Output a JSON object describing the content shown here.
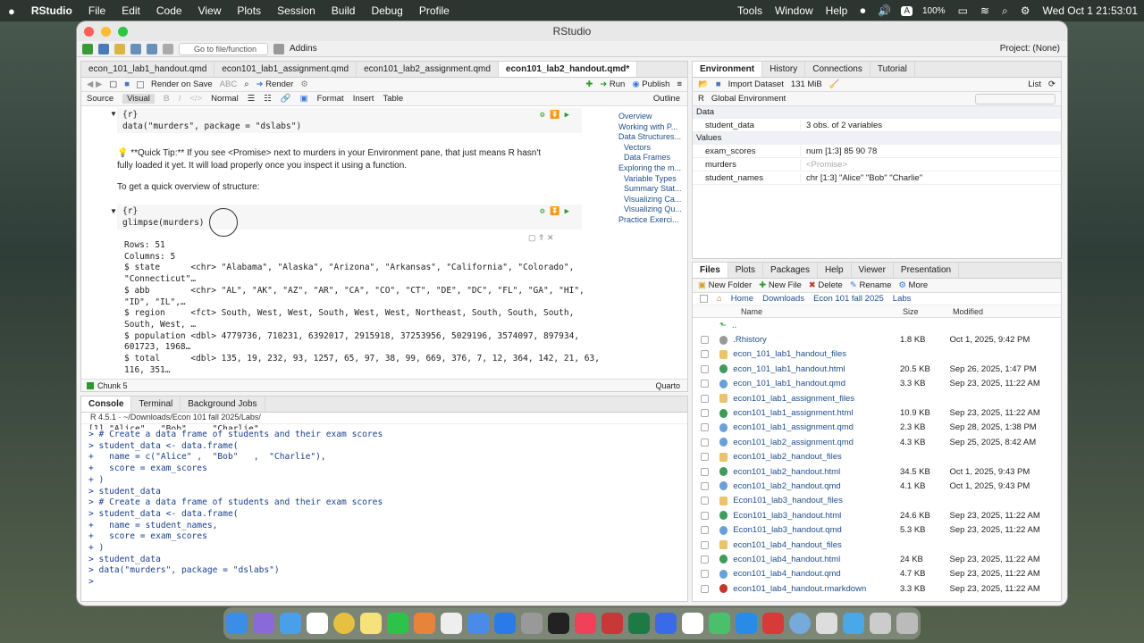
{
  "menubar": {
    "app": "RStudio",
    "items": [
      "File",
      "Edit",
      "Code",
      "View",
      "Plots",
      "Session",
      "Build",
      "Debug",
      "Profile"
    ],
    "right": [
      "Tools",
      "Window",
      "Help"
    ],
    "battery": "100%",
    "clock": "Wed Oct 1  21:53:01",
    "input_badge": "A"
  },
  "window": {
    "title": "RStudio"
  },
  "main_toolbar": {
    "goto_placeholder": "Go to file/function",
    "addins": "Addins",
    "project": "Project: (None)"
  },
  "editor": {
    "tabs": [
      "econ_101_lab1_handout.qmd",
      "econ101_lab1_assignment.qmd",
      "econ101_lab2_assignment.qmd",
      "econ101_lab2_handout.qmd*"
    ],
    "toolbar": {
      "render_on_save": "Render on Save",
      "render": "Render",
      "run": "Run",
      "publish": "Publish"
    },
    "toolbar2": {
      "source": "Source",
      "visual": "Visual",
      "style": "Normal",
      "format": "Format",
      "insert": "Insert",
      "table": "Table",
      "outline": "Outline"
    },
    "chunk1": {
      "header": "{r}",
      "code": "data(\"murders\", package = \"dslabs\")"
    },
    "tip_line1": "💡 **Quick Tip:** If you see  <Promise>  next to  murders  in your Environment pane, that just means R hasn't",
    "tip_line2": "fully loaded it yet. It will load properly once you inspect it using a function.",
    "overview_text": "To get a quick overview of structure:",
    "chunk2": {
      "header": "{r}",
      "code": "glimpse(murders)"
    },
    "output": [
      "Rows: 51",
      "Columns: 5",
      "$ state      <chr> \"Alabama\", \"Alaska\", \"Arizona\", \"Arkansas\", \"California\", \"Colorado\",",
      "\"Connecticut\"…",
      "$ abb        <chr> \"AL\", \"AK\", \"AZ\", \"AR\", \"CA\", \"CO\", \"CT\", \"DE\", \"DC\", \"FL\", \"GA\", \"HI\",",
      "\"ID\", \"IL\",…",
      "$ region     <fct> South, West, West, South, West, West, Northeast, South, South, South,",
      "South, West, …",
      "$ population <dbl> 4779736, 710231, 6392017, 2915918, 37253956, 5029196, 3574097, 897934,",
      "601723, 1968…",
      "$ total      <dbl> 135, 19, 232, 93, 1257, 65, 97, 38, 99, 669, 376, 7, 12, 364, 142, 21, 63,",
      "116, 351…"
    ],
    "outline": [
      "Overview",
      "Working with P...",
      "Data Structures...",
      "Vectors",
      "Data Frames",
      "Exploring the m...",
      "Variable Types",
      "Summary Stat...",
      "Visualizing Ca...",
      "Visualizing Qu...",
      "Practice Exerci..."
    ],
    "status": {
      "chunk": "Chunk 5",
      "mode": "Quarto"
    }
  },
  "console": {
    "tabs": [
      "Console",
      "Terminal",
      "Background Jobs"
    ],
    "path": "R 4.5.1 · ~/Downloads/Econ 101 fall 2025/Labs/",
    "lines": [
      "[1] \"Alice\"   \"Bob\"     \"Charlie\"",
      "> # Create a data frame of students and their exam scores",
      "> student_data <- data.frame(",
      "+   name = c(\"Alice\" ,  \"Bob\"   ,  \"Charlie\"),",
      "+   score = exam_scores",
      "+ )",
      "> student_data",
      "> # Create a data frame of students and their exam scores",
      "> student_data <- data.frame(",
      "+   name = student_names,",
      "+   score = exam_scores",
      "+ )",
      "> student_data",
      "> data(\"murders\", package = \"dslabs\")",
      "> "
    ]
  },
  "environment": {
    "tabs": [
      "Environment",
      "History",
      "Connections",
      "Tutorial"
    ],
    "import": "Import Dataset",
    "memory": "131 MiB",
    "view": "List",
    "lang": "R",
    "scope": "Global Environment",
    "data_header": "Data",
    "values_header": "Values",
    "data": [
      {
        "name": "student_data",
        "value": "3 obs. of 2 variables"
      }
    ],
    "values": [
      {
        "name": "exam_scores",
        "value": "num [1:3] 85 90 78"
      },
      {
        "name": "murders",
        "value": "<Promise>"
      },
      {
        "name": "student_names",
        "value": "chr [1:3] \"Alice\" \"Bob\" \"Charlie\""
      }
    ]
  },
  "files": {
    "tabs": [
      "Files",
      "Plots",
      "Packages",
      "Help",
      "Viewer",
      "Presentation"
    ],
    "toolbar": {
      "new_folder": "New Folder",
      "new_file": "New File",
      "delete": "Delete",
      "rename": "Rename",
      "more": "More"
    },
    "breadcrumb": [
      "Home",
      "Downloads",
      "Econ 101 fall 2025",
      "Labs"
    ],
    "headers": {
      "name": "Name",
      "size": "Size",
      "modified": "Modified"
    },
    "up": "..",
    "rows": [
      {
        "name": ".Rhistory",
        "size": "1.8 KB",
        "modified": "Oct 1, 2025, 9:42 PM",
        "kind": "doc"
      },
      {
        "name": "econ_101_lab1_handout_files",
        "size": "",
        "modified": "",
        "kind": "folder"
      },
      {
        "name": "econ_101_lab1_handout.html",
        "size": "20.5 KB",
        "modified": "Sep 26, 2025, 1:47 PM",
        "kind": "html"
      },
      {
        "name": "econ_101_lab1_handout.qmd",
        "size": "3.3 KB",
        "modified": "Sep 23, 2025, 11:22 AM",
        "kind": "qmd"
      },
      {
        "name": "econ101_lab1_assignment_files",
        "size": "",
        "modified": "",
        "kind": "folder"
      },
      {
        "name": "econ101_lab1_assignment.html",
        "size": "10.9 KB",
        "modified": "Sep 23, 2025, 11:22 AM",
        "kind": "html"
      },
      {
        "name": "econ101_lab1_assignment.qmd",
        "size": "2.3 KB",
        "modified": "Sep 28, 2025, 1:38 PM",
        "kind": "qmd"
      },
      {
        "name": "econ101_lab2_assignment.qmd",
        "size": "4.3 KB",
        "modified": "Sep 25, 2025, 8:42 AM",
        "kind": "qmd"
      },
      {
        "name": "econ101_lab2_handout_files",
        "size": "",
        "modified": "",
        "kind": "folder"
      },
      {
        "name": "econ101_lab2_handout.html",
        "size": "34.5 KB",
        "modified": "Oct 1, 2025, 9:43 PM",
        "kind": "html"
      },
      {
        "name": "econ101_lab2_handout.qmd",
        "size": "4.1 KB",
        "modified": "Oct 1, 2025, 9:43 PM",
        "kind": "qmd"
      },
      {
        "name": "Econ101_lab3_handout_files",
        "size": "",
        "modified": "",
        "kind": "folder"
      },
      {
        "name": "Econ101_lab3_handout.html",
        "size": "24.6 KB",
        "modified": "Sep 23, 2025, 11:22 AM",
        "kind": "html"
      },
      {
        "name": "Econ101_lab3_handout.qmd",
        "size": "5.3 KB",
        "modified": "Sep 23, 2025, 11:22 AM",
        "kind": "qmd"
      },
      {
        "name": "econ101_lab4_handout_files",
        "size": "",
        "modified": "",
        "kind": "folder"
      },
      {
        "name": "econ101_lab4_handout.html",
        "size": "24 KB",
        "modified": "Sep 23, 2025, 11:22 AM",
        "kind": "html"
      },
      {
        "name": "econ101_lab4_handout.qmd",
        "size": "4.7 KB",
        "modified": "Sep 23, 2025, 11:22 AM",
        "kind": "qmd"
      },
      {
        "name": "econ101_lab4_handout.rmarkdown",
        "size": "3.3 KB",
        "modified": "Sep 23, 2025, 11:22 AM",
        "kind": "rmd"
      }
    ]
  },
  "colors": {
    "accent": "#3a7bd5",
    "run_green": "#2a9a2a",
    "folder": "#e9c46a",
    "qmd": "#6aa0d8",
    "html": "#3f9b5a",
    "rmd": "#c0392b"
  }
}
